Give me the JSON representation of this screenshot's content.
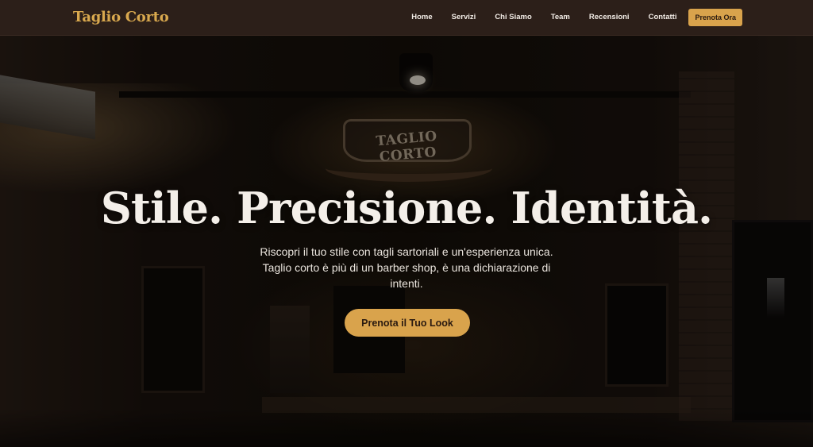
{
  "header": {
    "logo": "Taglio Corto",
    "nav": [
      "Home",
      "Servizi",
      "Chi Siamo",
      "Team",
      "Recensioni",
      "Contatti"
    ],
    "cta": "Prenota Ora"
  },
  "hero": {
    "sign_text": "TAGLIO CORTO",
    "title": "Stile. Precisione. Identità.",
    "subtitle": "Riscopri il tuo stile con tagli sartoriali e un'esperienza unica. Taglio corto è più di un barber shop, è una dichiarazione di intenti.",
    "cta": "Prenota il Tuo Look"
  },
  "colors": {
    "accent": "#d9a34c",
    "header_bg": "#2c1f19",
    "logo": "#d8a84e"
  }
}
